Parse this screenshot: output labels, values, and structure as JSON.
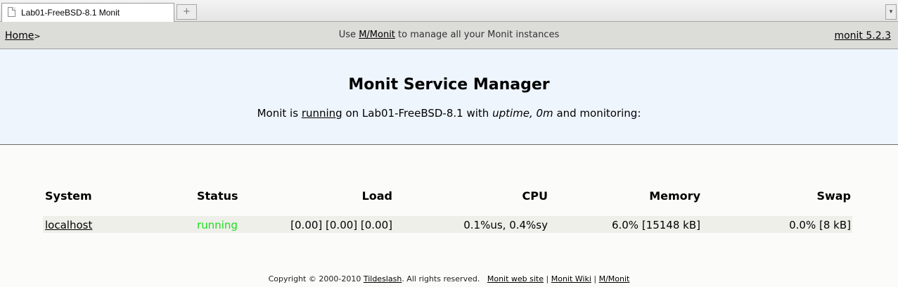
{
  "browser": {
    "tab_title": "Lab01-FreeBSD-8.1 Monit",
    "new_tab_glyph": "+",
    "tab_menu_glyph": "▾"
  },
  "header": {
    "home_label": "Home",
    "home_sep": ">",
    "note_prefix": "Use ",
    "note_link": "M/Monit",
    "note_suffix": " to manage all your Monit instances",
    "version": "monit 5.2.3"
  },
  "banner": {
    "title": "Monit Service Manager",
    "status_prefix": "Monit is ",
    "status_link": "running",
    "status_middle": " on Lab01-FreeBSD-8.1 with ",
    "uptime": "uptime, 0m",
    "status_suffix": "  and monitoring:"
  },
  "table": {
    "columns": [
      "System",
      "Status",
      "Load",
      "CPU",
      "Memory",
      "Swap"
    ],
    "rows": [
      {
        "system": "localhost",
        "status": "running",
        "load": "[0.00] [0.00] [0.00]",
        "cpu": "0.1%us, 0.4%sy",
        "memory": "6.0% [15148 kB]",
        "swap": "0.0% [8 kB]"
      }
    ]
  },
  "footer": {
    "copyright_prefix": "Copyright © 2000-2010 ",
    "company_link": "Tildeslash",
    "copyright_suffix": ". All rights reserved.",
    "link_web": "Monit web site",
    "sep1": " | ",
    "link_wiki": "Monit Wiki",
    "sep2": " | ",
    "link_mmonit": "M/Monit"
  },
  "colors": {
    "running": "#19e019",
    "banner_bg": "#eef5fd",
    "header_bg": "#dcdcd8",
    "row_bg": "#efefea"
  }
}
